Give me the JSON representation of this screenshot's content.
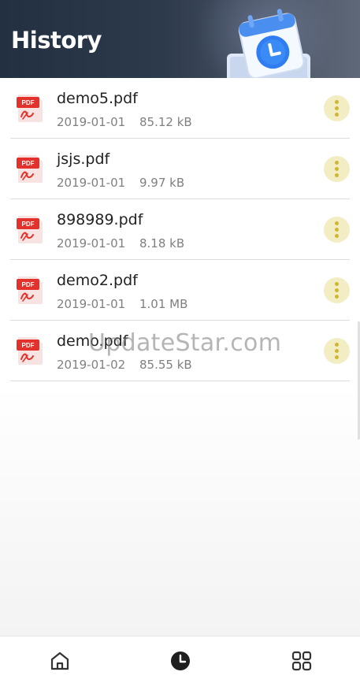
{
  "header": {
    "title": "History",
    "illustration": "calendar-clock-illustration"
  },
  "files": [
    {
      "name": "demo5.pdf",
      "date": "2019-01-01",
      "size": "85.12 kB",
      "icon": "pdf-file-icon",
      "action_icon": "more-vert-icon"
    },
    {
      "name": "jsjs.pdf",
      "date": "2019-01-01",
      "size": "9.97 kB",
      "icon": "pdf-file-icon",
      "action_icon": "more-vert-icon"
    },
    {
      "name": "898989.pdf",
      "date": "2019-01-01",
      "size": "8.18 kB",
      "icon": "pdf-file-icon",
      "action_icon": "more-vert-icon"
    },
    {
      "name": "demo2.pdf",
      "date": "2019-01-01",
      "size": "1.01 MB",
      "icon": "pdf-file-icon",
      "action_icon": "more-vert-icon"
    },
    {
      "name": "demo.pdf",
      "date": "2019-01-02",
      "size": "85.55 kB",
      "icon": "pdf-file-icon",
      "action_icon": "more-vert-icon"
    }
  ],
  "watermark": "UpdateStar.com",
  "pdf_badge": "PDF",
  "tabbar": {
    "items": [
      {
        "icon": "home-icon",
        "active": false
      },
      {
        "icon": "clock-icon",
        "active": true
      },
      {
        "icon": "grid-icon",
        "active": false
      }
    ]
  },
  "colors": {
    "header_bg": "#223041",
    "pdf_red": "#e3322b",
    "more_bg": "#f2edc2",
    "more_dots": "#d2b632"
  }
}
